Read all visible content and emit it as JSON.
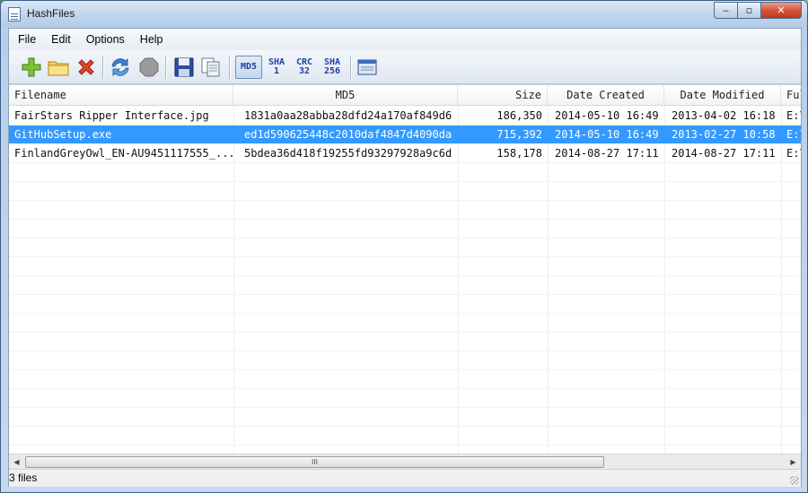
{
  "window": {
    "title": "HashFiles",
    "minimize": "‒",
    "maximize": "▫",
    "close": "✕"
  },
  "menu": [
    "File",
    "Edit",
    "Options",
    "Help"
  ],
  "toolbar": {
    "hash_buttons": [
      {
        "line1": "MD5",
        "line2": "",
        "active": true
      },
      {
        "line1": "SHA",
        "line2": "1",
        "active": false
      },
      {
        "line1": "CRC",
        "line2": "32",
        "active": false
      },
      {
        "line1": "SHA",
        "line2": "256",
        "active": false
      }
    ]
  },
  "columns": [
    "Filename",
    "MD5",
    "Size",
    "Date Created",
    "Date Modified",
    "Ful"
  ],
  "rows": [
    {
      "filename": "FairStars Ripper Interface.jpg",
      "md5": "1831a0aa28abba28dfd24a170af849d6",
      "size": "186,350",
      "created": "2014-05-10 16:49",
      "modified": "2013-04-02 16:18",
      "full": "E:\\",
      "selected": false
    },
    {
      "filename": "GitHubSetup.exe",
      "md5": "ed1d590625448c2010daf4847d4090da",
      "size": "715,392",
      "created": "2014-05-10 16:49",
      "modified": "2013-02-27 10:58",
      "full": "E:\\",
      "selected": true
    },
    {
      "filename": "FinlandGreyOwl_EN-AU9451117555_...",
      "md5": "5bdea36d418f19255fd93297928a9c6d",
      "size": "158,178",
      "created": "2014-08-27 17:11",
      "modified": "2014-08-27 17:11",
      "full": "E:\\",
      "selected": false
    }
  ],
  "scrollbar": {
    "left": "◀",
    "right": "▶",
    "thumb": "III"
  },
  "status": "3 files",
  "colors": {
    "selection": "#3399ff",
    "accent": "#1c3fa8"
  }
}
